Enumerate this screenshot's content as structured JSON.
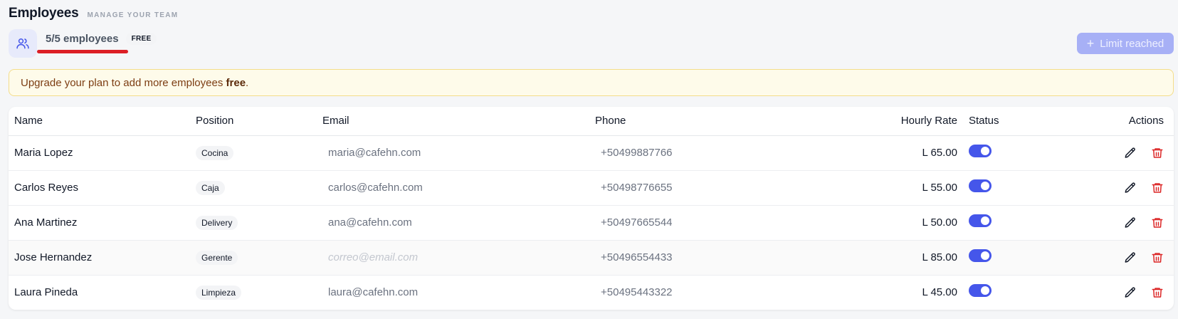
{
  "header": {
    "title": "Employees",
    "subtitle": "MANAGE YOUR TEAM"
  },
  "stats": {
    "count_text": "5/5 employees",
    "plan_badge": "FREE",
    "icon": "users-icon"
  },
  "limit_button": {
    "label": "Limit reached",
    "icon": "plus-icon"
  },
  "banner": {
    "text_prefix": "Upgrade your plan to add more employees ",
    "text_bold": "free",
    "text_suffix": "."
  },
  "table": {
    "headers": {
      "name": "Name",
      "position": "Position",
      "email": "Email",
      "phone": "Phone",
      "rate": "Hourly Rate",
      "status": "Status",
      "actions": "Actions"
    },
    "rows": [
      {
        "name": "Maria Lopez",
        "position": "Cocina",
        "email": "maria@cafehn.com",
        "phone": "+50499887766",
        "rate": "L 65.00",
        "active": true
      },
      {
        "name": "Carlos Reyes",
        "position": "Caja",
        "email": "carlos@cafehn.com",
        "phone": "+50498776655",
        "rate": "L 55.00",
        "active": true
      },
      {
        "name": "Ana Martinez",
        "position": "Delivery",
        "email": "ana@cafehn.com",
        "phone": "+50497665544",
        "rate": "L 50.00",
        "active": true
      },
      {
        "name": "Jose Hernandez",
        "position": "Gerente",
        "email": "",
        "email_placeholder": "correo@email.com",
        "phone": "+50496554433",
        "rate": "L 85.00",
        "active": true
      },
      {
        "name": "Laura Pineda",
        "position": "Limpieza",
        "email": "laura@cafehn.com",
        "phone": "+50495443322",
        "rate": "L 45.00",
        "active": true
      }
    ]
  },
  "colors": {
    "accent": "#4556ea",
    "danger": "#dc2626",
    "banner_bg": "#fefbea"
  }
}
